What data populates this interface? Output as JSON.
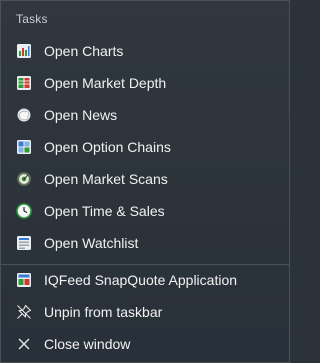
{
  "jumplist": {
    "section_label": "Tasks",
    "tasks": [
      {
        "label": "Open Charts",
        "icon": "charts-icon"
      },
      {
        "label": "Open Market Depth",
        "icon": "market-depth-icon"
      },
      {
        "label": "Open News",
        "icon": "news-icon"
      },
      {
        "label": "Open Option Chains",
        "icon": "option-chains-icon"
      },
      {
        "label": "Open Market Scans",
        "icon": "market-scans-icon"
      },
      {
        "label": "Open Time & Sales",
        "icon": "time-sales-icon"
      },
      {
        "label": "Open Watchlist",
        "icon": "watchlist-icon"
      }
    ],
    "app_label": "IQFeed SnapQuote Application",
    "unpin_label": "Unpin from taskbar",
    "close_label": "Close window"
  }
}
